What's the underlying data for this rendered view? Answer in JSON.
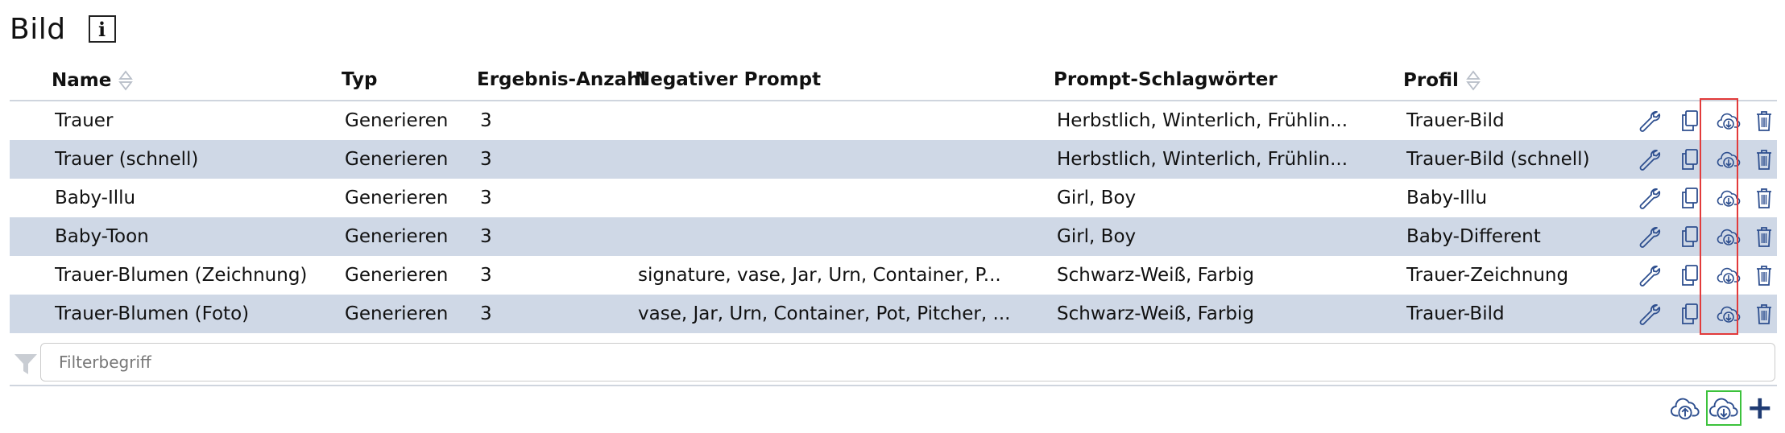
{
  "page": {
    "title": "Bild",
    "info_label": "i"
  },
  "table": {
    "columns": {
      "name": "Name",
      "typ": "Typ",
      "count": "Ergebnis-Anzahl",
      "negative": "Negativer Prompt",
      "keywords": "Prompt-Schlagwörter",
      "profile": "Profil"
    },
    "rows": [
      {
        "name": "Trauer",
        "typ": "Generieren",
        "count": "3",
        "negative": "",
        "keywords": "Herbstlich, Winterlich, Frühlin...",
        "profile": "Trauer-Bild"
      },
      {
        "name": "Trauer (schnell)",
        "typ": "Generieren",
        "count": "3",
        "negative": "",
        "keywords": "Herbstlich, Winterlich, Frühlin...",
        "profile": "Trauer-Bild (schnell)"
      },
      {
        "name": "Baby-Illu",
        "typ": "Generieren",
        "count": "3",
        "negative": "",
        "keywords": "Girl, Boy",
        "profile": "Baby-Illu"
      },
      {
        "name": "Baby-Toon",
        "typ": "Generieren",
        "count": "3",
        "negative": "",
        "keywords": "Girl, Boy",
        "profile": "Baby-Different"
      },
      {
        "name": "Trauer-Blumen (Zeichnung)",
        "typ": "Generieren",
        "count": "3",
        "negative": "signature, vase, Jar, Urn, Container, P...",
        "keywords": "Schwarz-Weiß, Farbig",
        "profile": "Trauer-Zeichnung"
      },
      {
        "name": "Trauer-Blumen (Foto)",
        "typ": "Generieren",
        "count": "3",
        "negative": "vase, Jar, Urn, Container, Pot, Pitcher, ...",
        "keywords": "Schwarz-Weiß, Farbig",
        "profile": "Trauer-Bild"
      }
    ]
  },
  "filter": {
    "placeholder": "Filterbegriff",
    "value": ""
  },
  "bottom": {
    "add_label": "+"
  },
  "colors": {
    "icon": "#2e4f8f",
    "row_alt": "#cfd8e6",
    "highlight_red": "#e23b3b",
    "highlight_green": "#3cc23c"
  },
  "icons": [
    "info-icon",
    "sort-icon",
    "wrench-icon",
    "copy-icon",
    "cloud-download-icon",
    "trash-icon",
    "filter-icon",
    "cloud-upload-icon",
    "plus-icon"
  ]
}
